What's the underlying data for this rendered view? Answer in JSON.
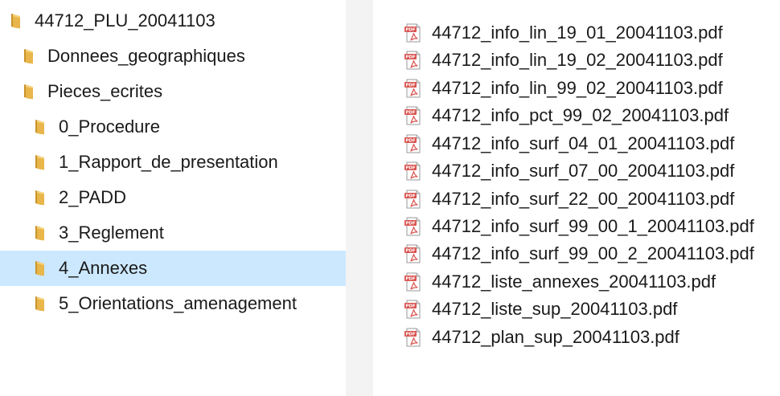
{
  "tree": {
    "items": [
      {
        "label": "44712_PLU_20041103",
        "depth": 0,
        "selected": false
      },
      {
        "label": "Donnees_geographiques",
        "depth": 1,
        "selected": false
      },
      {
        "label": "Pieces_ecrites",
        "depth": 1,
        "selected": false
      },
      {
        "label": "0_Procedure",
        "depth": 2,
        "selected": false
      },
      {
        "label": "1_Rapport_de_presentation",
        "depth": 2,
        "selected": false
      },
      {
        "label": "2_PADD",
        "depth": 2,
        "selected": false
      },
      {
        "label": "3_Reglement",
        "depth": 2,
        "selected": false
      },
      {
        "label": "4_Annexes",
        "depth": 2,
        "selected": true
      },
      {
        "label": "5_Orientations_amenagement",
        "depth": 2,
        "selected": false
      }
    ]
  },
  "files": {
    "icon": "pdf-file-icon",
    "items": [
      "44712_info_lin_19_01_20041103.pdf",
      "44712_info_lin_19_02_20041103.pdf",
      "44712_info_lin_99_02_20041103.pdf",
      "44712_info_pct_99_02_20041103.pdf",
      "44712_info_surf_04_01_20041103.pdf",
      "44712_info_surf_07_00_20041103.pdf",
      "44712_info_surf_22_00_20041103.pdf",
      "44712_info_surf_99_00_1_20041103.pdf",
      "44712_info_surf_99_00_2_20041103.pdf",
      "44712_liste_annexes_20041103.pdf",
      "44712_liste_sup_20041103.pdf",
      "44712_plan_sup_20041103.pdf"
    ]
  },
  "colors": {
    "selection": "#cce8ff",
    "folder": "#e8b64a",
    "pdf_red": "#d9534f"
  }
}
